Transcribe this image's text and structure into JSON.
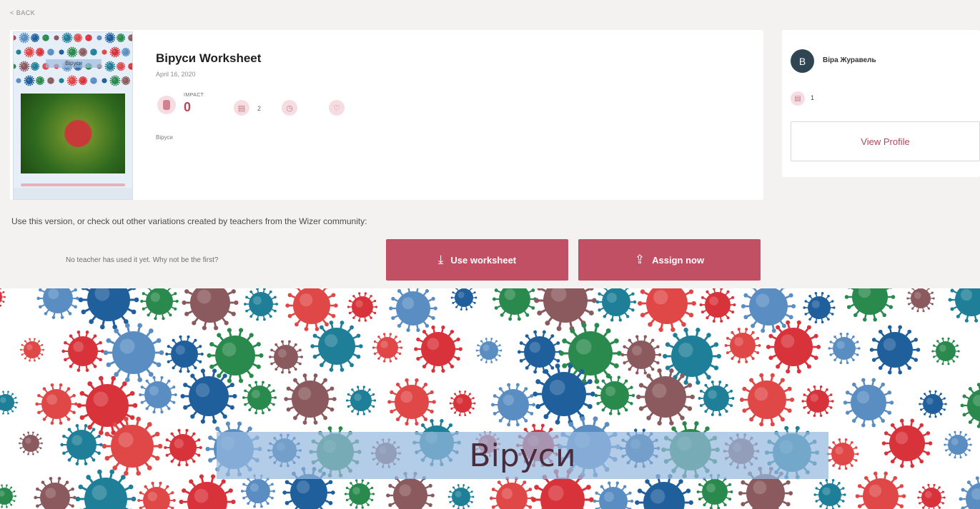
{
  "nav": {
    "back_label": "< BACK"
  },
  "worksheet": {
    "title": "Віруси Worksheet",
    "date": "April 16, 2020",
    "impact_label": "IMPACT",
    "impact_value": "0",
    "stats": [
      {
        "icon": "worksheet-icon",
        "count": "2"
      },
      {
        "icon": "assign-icon",
        "count": ""
      },
      {
        "icon": "like-icon",
        "count": ""
      }
    ],
    "tag": "Віруси",
    "thumbnail_title": "Віруси"
  },
  "author": {
    "initial": "В",
    "name": "Віра Журавель",
    "stat_count": "1",
    "view_profile_label": "View Profile"
  },
  "variations_text": "Use this version, or check out other variations created by teachers from the Wizer community:",
  "no_teacher_text": "No teacher has used it yet. Why not be the first?",
  "actions": {
    "use_label": "Use worksheet",
    "assign_label": "Assign now"
  },
  "preview": {
    "title": "Віруси"
  },
  "colors": {
    "accent": "#c25064",
    "avatar": "#2f4552",
    "background": "#f4f2f1"
  }
}
